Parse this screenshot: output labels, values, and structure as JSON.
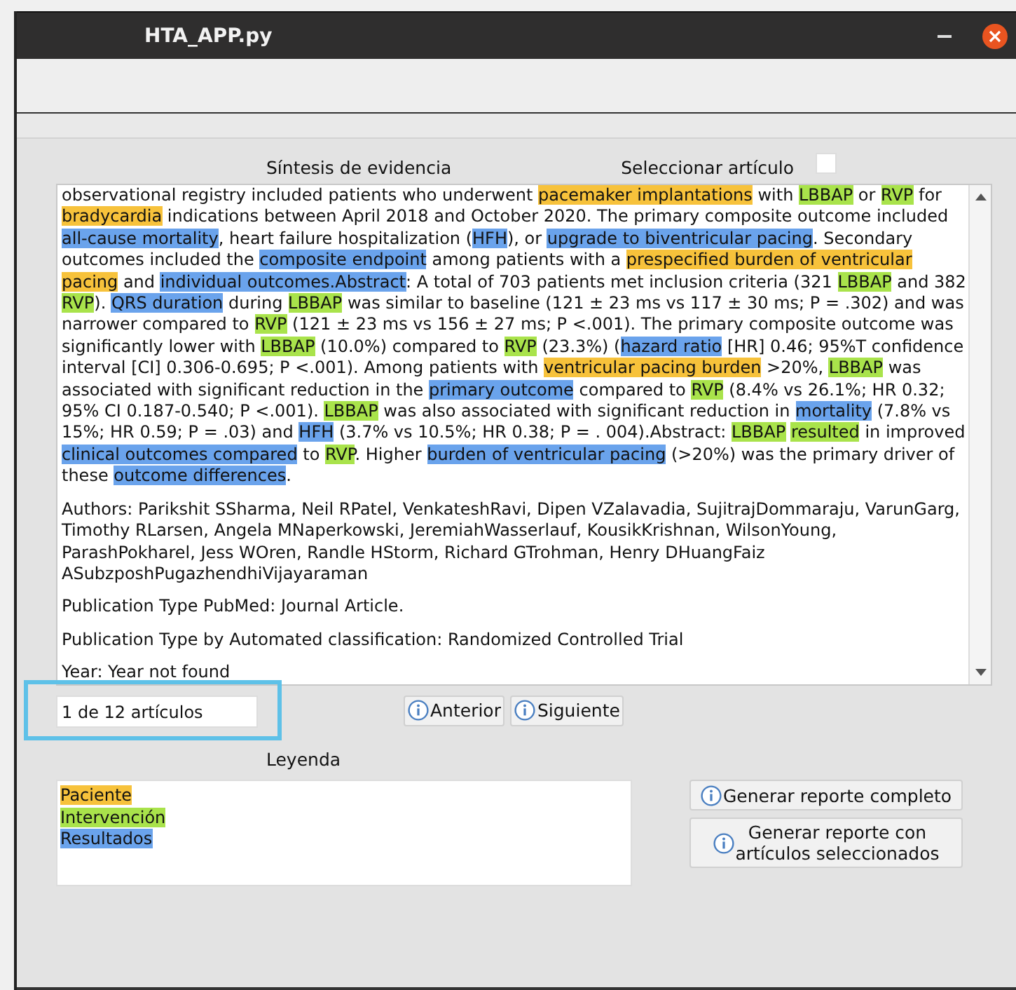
{
  "window": {
    "title": "HTA_APP.py"
  },
  "header": {
    "synthesis_label": "Síntesis de evidencia",
    "select_label": "Seleccionar artículo",
    "select_checked": false
  },
  "article": {
    "abstract": [
      {
        "text": "observational registry included patients who underwent ",
        "kind": "plain"
      },
      {
        "text": "pacemaker implantations",
        "kind": "patient"
      },
      {
        "text": " with ",
        "kind": "plain"
      },
      {
        "text": "LBBAP",
        "kind": "intervention"
      },
      {
        "text": " or ",
        "kind": "plain"
      },
      {
        "text": "RVP",
        "kind": "intervention"
      },
      {
        "text": " for ",
        "kind": "plain"
      },
      {
        "text": "bradycardia",
        "kind": "patient"
      },
      {
        "text": " indications between April 2018 and October 2020. The primary composite outcome included ",
        "kind": "plain"
      },
      {
        "text": "all-cause mortality",
        "kind": "outcome"
      },
      {
        "text": ", heart failure hospitalization (",
        "kind": "plain"
      },
      {
        "text": "HFH",
        "kind": "outcome"
      },
      {
        "text": "), or ",
        "kind": "plain"
      },
      {
        "text": "upgrade to biventricular pacing",
        "kind": "outcome"
      },
      {
        "text": ". Secondary outcomes included the ",
        "kind": "plain"
      },
      {
        "text": "composite endpoint",
        "kind": "outcome"
      },
      {
        "text": " among patients with a ",
        "kind": "plain"
      },
      {
        "text": "prespecified burden of ventricular pacing",
        "kind": "patient"
      },
      {
        "text": " and ",
        "kind": "plain"
      },
      {
        "text": "individual outcomes.Abstract",
        "kind": "outcome"
      },
      {
        "text": ": A total of 703 patients met inclusion criteria (321 ",
        "kind": "plain"
      },
      {
        "text": "LBBAP",
        "kind": "intervention"
      },
      {
        "text": " and 382 ",
        "kind": "plain"
      },
      {
        "text": "RVP",
        "kind": "intervention"
      },
      {
        "text": "). ",
        "kind": "plain"
      },
      {
        "text": "QRS duration",
        "kind": "outcome"
      },
      {
        "text": " during ",
        "kind": "plain"
      },
      {
        "text": "LBBAP",
        "kind": "intervention"
      },
      {
        "text": " was similar to baseline (121 ± 23 ms vs 117 ± 30 ms; P = .302) and was narrower compared to ",
        "kind": "plain"
      },
      {
        "text": "RVP",
        "kind": "intervention"
      },
      {
        "text": " (121 ± 23 ms vs 156 ± 27 ms; P <.001). The primary composite outcome was significantly lower with ",
        "kind": "plain"
      },
      {
        "text": "LBBAP",
        "kind": "intervention"
      },
      {
        "text": " (10.0%) compared to ",
        "kind": "plain"
      },
      {
        "text": "RVP",
        "kind": "intervention"
      },
      {
        "text": " (23.3%) (",
        "kind": "plain"
      },
      {
        "text": "hazard ratio",
        "kind": "outcome"
      },
      {
        "text": " [HR] 0.46; 95%T confidence interval [CI] 0.306-0.695; P <.001). Among patients with ",
        "kind": "plain"
      },
      {
        "text": "ventricular pacing burden",
        "kind": "patient"
      },
      {
        "text": " >20%, ",
        "kind": "plain"
      },
      {
        "text": "LBBAP",
        "kind": "intervention"
      },
      {
        "text": " was associated with significant reduction in the ",
        "kind": "plain"
      },
      {
        "text": "primary outcome",
        "kind": "outcome"
      },
      {
        "text": " compared to ",
        "kind": "plain"
      },
      {
        "text": "RVP",
        "kind": "intervention"
      },
      {
        "text": " (8.4% vs 26.1%; HR 0.32; 95% CI 0.187-0.540; P <.001). ",
        "kind": "plain"
      },
      {
        "text": "LBBAP",
        "kind": "intervention"
      },
      {
        "text": " was also associated with significant reduction in ",
        "kind": "plain"
      },
      {
        "text": "mortality",
        "kind": "outcome"
      },
      {
        "text": " (7.8% vs 15%; HR 0.59; P = .03) and ",
        "kind": "plain"
      },
      {
        "text": "HFH",
        "kind": "outcome"
      },
      {
        "text": " (3.7% vs 10.5%; HR 0.38; P = . 004).Abstract: ",
        "kind": "plain"
      },
      {
        "text": "LBBAP",
        "kind": "intervention"
      },
      {
        "text": " resulted",
        "kind": "intervention"
      },
      {
        "text": " in improved ",
        "kind": "plain"
      },
      {
        "text": "clinical outcomes compared",
        "kind": "outcome"
      },
      {
        "text": " to ",
        "kind": "plain"
      },
      {
        "text": "RVP",
        "kind": "intervention"
      },
      {
        "text": ". Higher ",
        "kind": "plain"
      },
      {
        "text": "burden of ventricular pacing",
        "kind": "outcome"
      },
      {
        "text": " (>20%) was the primary driver of these ",
        "kind": "plain"
      },
      {
        "text": "outcome differences",
        "kind": "outcome"
      },
      {
        "text": ".",
        "kind": "plain"
      }
    ],
    "details": [
      "Authors: Parikshit SSharma, Neil RPatel, VenkateshRavi, Dipen VZalavadia, SujitrajDommaraju, VarunGarg, Timothy RLarsen, Angela MNaperkowski, JeremiahWasserlauf, KousikKrishnan, WilsonYoung, ParashPokharel, Jess WOren, Randle HStorm, Richard GTrohman, Henry DHuangFaiz ASubzposhPugazhendhiVijayaraman",
      "Publication Type PubMed: Journal Article.",
      "Publication Type by Automated classification: Randomized Controlled Trial",
      "Year: Year not found"
    ]
  },
  "navigation": {
    "counter": "1 de 12 artículos",
    "buttons": [
      "Anterior",
      "Siguiente"
    ]
  },
  "legend": {
    "label": "Leyenda",
    "items": [
      {
        "label": "Paciente",
        "kind": "patient",
        "color": "#f7c23b"
      },
      {
        "label": "Intervención",
        "kind": "intervention",
        "color": "#a9e34b"
      },
      {
        "label": "Resultados",
        "kind": "outcome",
        "color": "#6aa3ec"
      }
    ]
  },
  "actions": [
    "Generar reporte completo",
    "Generar reporte con\nartículos seleccionados"
  ]
}
